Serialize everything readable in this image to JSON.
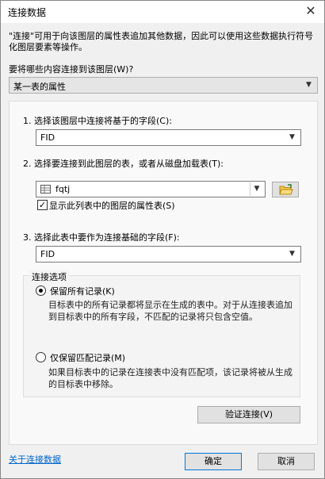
{
  "window": {
    "title": "连接数据",
    "close_glyph": "✕"
  },
  "description": "\"连接\"可用于向该图层的属性表追加其他数据，因此可以使用这些数据执行符号化图层要素等操作。",
  "join_what": {
    "label": "要将哪些内容连接到该图层(W)?",
    "selected": "某一表的属性"
  },
  "step1": {
    "label": "1.  选择该图层中连接将基于的字段(C):",
    "selected": "FID"
  },
  "step2": {
    "label": "2.  选择要连接到此图层的表，或者从磁盘加载表(T):",
    "table_selected": "fqtj",
    "show_attr_tables_label": "显示此列表中的图层的属性表(S)",
    "show_attr_tables_checked": true
  },
  "step3": {
    "label": "3.  选择此表中要作为连接基础的字段(F):",
    "selected": "FID"
  },
  "join_options": {
    "title": "连接选项",
    "keep_all": {
      "label": "保留所有记录(K)",
      "checked": true,
      "help": "目标表中的所有记录都将显示在生成的表中。对于从连接表追加到目标表中的所有字段，不匹配的记录将只包含空值。"
    },
    "keep_matching": {
      "label": "仅保留匹配记录(M)",
      "checked": false,
      "help": "如果目标表中的记录在连接表中没有匹配项，该记录将被从生成的目标表中移除。"
    }
  },
  "validate_button": "验证连接(V)",
  "about_link": "关于连接数据",
  "ok_button": "确定",
  "cancel_button": "取消"
}
